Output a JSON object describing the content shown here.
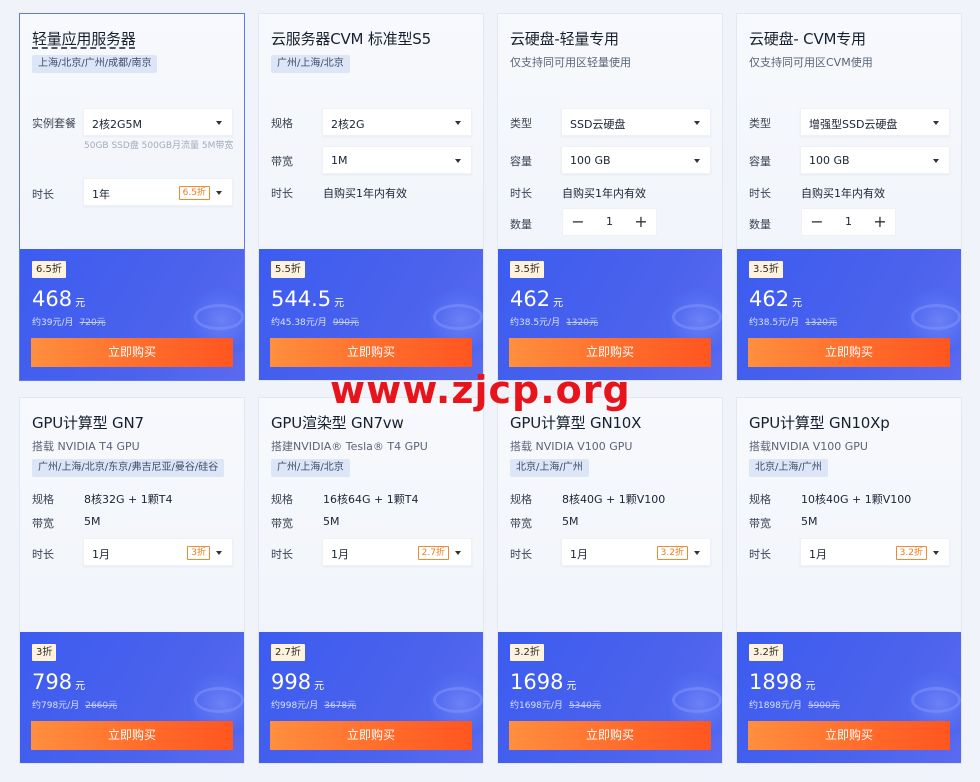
{
  "watermark": "www.zjcp.org",
  "cards": [
    {
      "title": "轻量应用服务器",
      "tag": "上海/北京/广州/成都/南京",
      "rows": {
        "r1_label": "实例套餐",
        "r1_value": "2核2G5M",
        "note": "50GB SSD盘 500GB月流量 5M带宽",
        "r2_label": "时长",
        "r2_value": "1年",
        "r2_discount": "6.5折"
      },
      "discount": "6.5折",
      "price": "468",
      "unit": "元",
      "per_month": "约39元/月",
      "original": "720元",
      "buy": "立即购买"
    },
    {
      "title": "云服务器CVM 标准型S5",
      "tag": "广州/上海/北京",
      "rows": {
        "r1_label": "规格",
        "r1_value": "2核2G",
        "r2_label": "带宽",
        "r2_value": "1M",
        "r3_label": "时长",
        "r3_value": "自购买1年内有效"
      },
      "discount": "5.5折",
      "price": "544.5",
      "unit": "元",
      "per_month": "约45.38元/月",
      "original": "990元",
      "buy": "立即购买"
    },
    {
      "title": "云硬盘-轻量专用",
      "subtitle": "仅支持同可用区轻量使用",
      "rows": {
        "r1_label": "类型",
        "r1_value": "SSD云硬盘",
        "r2_label": "容量",
        "r2_value": "100 GB",
        "r3_label": "时长",
        "r3_value": "自购买1年内有效",
        "r4_label": "数量",
        "qty": "1",
        "minus": "−",
        "plus": "+"
      },
      "discount": "3.5折",
      "price": "462",
      "unit": "元",
      "per_month": "约38.5元/月",
      "original": "1320元",
      "buy": "立即购买"
    },
    {
      "title": "云硬盘- CVM专用",
      "subtitle": "仅支持同可用区CVM使用",
      "rows": {
        "r1_label": "类型",
        "r1_value": "增强型SSD云硬盘",
        "r2_label": "容量",
        "r2_value": "100 GB",
        "r3_label": "时长",
        "r3_value": "自购买1年内有效",
        "r4_label": "数量",
        "qty": "1",
        "minus": "−",
        "plus": "+"
      },
      "discount": "3.5折",
      "price": "462",
      "unit": "元",
      "per_month": "约38.5元/月",
      "original": "1320元",
      "buy": "立即购买"
    },
    {
      "title": "GPU计算型 GN7",
      "subtitle": "搭载 NVIDIA T4 GPU",
      "tag": "广州/上海/北京/东京/弗吉尼亚/曼谷/硅谷",
      "rows": {
        "r1_label": "规格",
        "r1_value": "8核32G + 1颗T4",
        "r2_label": "带宽",
        "r2_value": "5M",
        "r3_label": "时长",
        "r3_value": "1月",
        "r3_discount": "3折"
      },
      "discount": "3折",
      "price": "798",
      "unit": "元",
      "per_month": "约798元/月",
      "original": "2660元",
      "buy": "立即购买"
    },
    {
      "title": "GPU渲染型 GN7vw",
      "subtitle": "搭建NVIDIA® Tesla® T4 GPU",
      "tag": "广州/上海/北京",
      "rows": {
        "r1_label": "规格",
        "r1_value": "16核64G + 1颗T4",
        "r2_label": "带宽",
        "r2_value": "5M",
        "r3_label": "时长",
        "r3_value": "1月",
        "r3_discount": "2.7折"
      },
      "discount": "2.7折",
      "price": "998",
      "unit": "元",
      "per_month": "约998元/月",
      "original": "3678元",
      "buy": "立即购买"
    },
    {
      "title": "GPU计算型 GN10X",
      "subtitle": "搭载 NVIDIA V100 GPU",
      "tag": "北京/上海/广州",
      "rows": {
        "r1_label": "规格",
        "r1_value": "8核40G + 1颗V100",
        "r2_label": "带宽",
        "r2_value": "5M",
        "r3_label": "时长",
        "r3_value": "1月",
        "r3_discount": "3.2折"
      },
      "discount": "3.2折",
      "price": "1698",
      "unit": "元",
      "per_month": "约1698元/月",
      "original": "5340元",
      "buy": "立即购买"
    },
    {
      "title": "GPU计算型 GN10Xp",
      "subtitle": "搭载NVIDIA V100 GPU",
      "tag": "北京/上海/广州",
      "rows": {
        "r1_label": "规格",
        "r1_value": "10核40G + 1颗V100",
        "r2_label": "带宽",
        "r2_value": "5M",
        "r3_label": "时长",
        "r3_value": "1月",
        "r3_discount": "3.2折"
      },
      "discount": "3.2折",
      "price": "1898",
      "unit": "元",
      "per_month": "约1898元/月",
      "original": "5900元",
      "buy": "立即购买"
    }
  ]
}
